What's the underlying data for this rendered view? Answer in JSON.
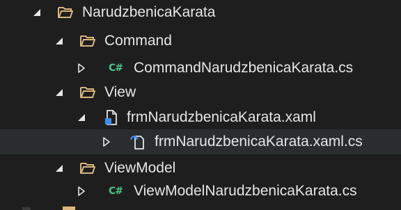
{
  "solution_explorer": {
    "items": [
      {
        "label": "NarudzbenicaKarata",
        "icon": "folder-open-icon",
        "expanded": true
      },
      {
        "label": "Command",
        "icon": "folder-open-icon",
        "expanded": true
      },
      {
        "label": "CommandNarudzbenicaKarata.cs",
        "icon": "csharp-file-icon",
        "icon_text": "C#",
        "expanded": false
      },
      {
        "label": "View",
        "icon": "folder-open-icon",
        "expanded": true
      },
      {
        "label": "frmNarudzbenicaKarata.xaml",
        "icon": "xaml-file-icon",
        "expanded": true
      },
      {
        "label": "frmNarudzbenicaKarata.xaml.cs",
        "icon": "xaml-codebehind-icon",
        "expanded": false
      },
      {
        "label": "ViewModel",
        "icon": "folder-open-icon",
        "expanded": true
      },
      {
        "label": "ViewModelNarudzbenicaKarata.cs",
        "icon": "csharp-file-icon",
        "icon_text": "C#",
        "expanded": false
      }
    ]
  },
  "colors": {
    "background": "#1e1e1e",
    "text": "#e6e6e6",
    "folder": "#dcb67a",
    "csharp": "#4ec48a",
    "xaml_blue": "#3b8eea"
  }
}
